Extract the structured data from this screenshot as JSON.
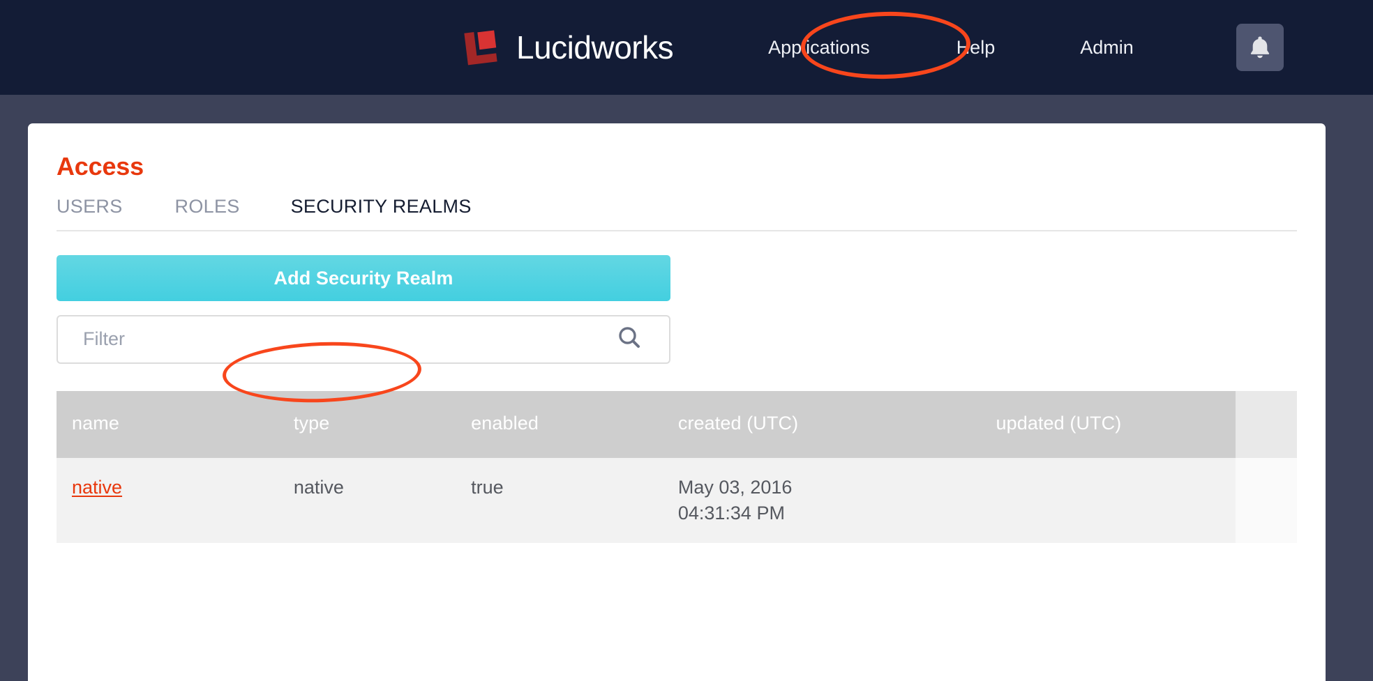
{
  "topbar": {
    "brand_name": "Lucidworks",
    "logo_icon": "lucidworks-logo",
    "nav": [
      {
        "key": "applications",
        "label": "Applications"
      },
      {
        "key": "help",
        "label": "Help"
      },
      {
        "key": "admin",
        "label": "Admin"
      }
    ],
    "notifications_icon": "bell-icon",
    "background_color": "#131c36"
  },
  "page": {
    "background_color": "#3d4259",
    "title": "Access",
    "title_color": "#e8380d"
  },
  "tabs": [
    {
      "key": "users",
      "label": "USERS",
      "active": false
    },
    {
      "key": "roles",
      "label": "ROLES",
      "active": false
    },
    {
      "key": "security-realms",
      "label": "SECURITY REALMS",
      "active": true
    }
  ],
  "actions": {
    "add_label": "Add Security Realm",
    "add_color": "#43cfe0"
  },
  "filter": {
    "value": "",
    "placeholder": "Filter",
    "search_icon": "search-icon"
  },
  "table": {
    "columns": [
      {
        "key": "name",
        "label": "name"
      },
      {
        "key": "type",
        "label": "type"
      },
      {
        "key": "enabled",
        "label": "enabled"
      },
      {
        "key": "created",
        "label": "created (UTC)"
      },
      {
        "key": "updated",
        "label": "updated (UTC)"
      }
    ],
    "rows": [
      {
        "name": "native",
        "type": "native",
        "enabled": "true",
        "created_date": "May 03, 2016",
        "created_time": "04:31:34 PM",
        "updated": ""
      }
    ]
  },
  "annotations": [
    {
      "key": "applications",
      "target": "Applications",
      "color": "#f8461c"
    },
    {
      "key": "security-realms",
      "target": "SECURITY REALMS",
      "color": "#f8461c"
    }
  ]
}
